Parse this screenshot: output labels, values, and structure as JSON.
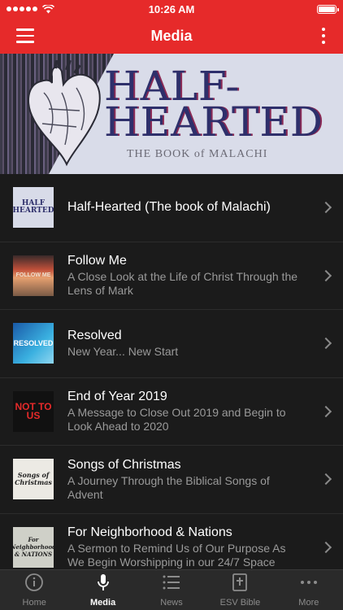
{
  "status_bar": {
    "time": "10:26 AM"
  },
  "nav": {
    "title": "Media"
  },
  "banner": {
    "title_line1": "HALF-",
    "title_line2": "HEARTED",
    "subtitle": "THE BOOK of MALACHI"
  },
  "list": {
    "items": [
      {
        "title": "Half-Hearted (The book of Malachi)",
        "subtitle": "",
        "thumb_text": "HALF HEARTED"
      },
      {
        "title": "Follow Me",
        "subtitle": "A Close Look at the Life of Christ Through the Lens of Mark",
        "thumb_text": "FOLLOW ME"
      },
      {
        "title": "Resolved",
        "subtitle": "New Year... New Start",
        "thumb_text": "RESOLVED"
      },
      {
        "title": "End of Year 2019",
        "subtitle": "A Message to Close Out 2019 and Begin to Look Ahead to 2020",
        "thumb_text": "NOT TO US"
      },
      {
        "title": "Songs of Christmas",
        "subtitle": "A Journey Through the Biblical Songs of Advent",
        "thumb_text": "Songs of Christmas"
      },
      {
        "title": "For Neighborhood & Nations",
        "subtitle": "A Sermon to Remind Us of Our Purpose As We Begin Worshipping in our 24/7 Space",
        "thumb_text": "For Neighborhood & NATIONS"
      }
    ]
  },
  "tabs": [
    {
      "label": "Home",
      "icon": "info-icon"
    },
    {
      "label": "Media",
      "icon": "microphone-icon"
    },
    {
      "label": "News",
      "icon": "list-icon"
    },
    {
      "label": "ESV Bible",
      "icon": "bible-icon"
    },
    {
      "label": "More",
      "icon": "more-icon"
    }
  ],
  "colors": {
    "accent": "#e62a2a",
    "background": "#1b1b1b",
    "tab_bar": "#2a2a2a"
  }
}
